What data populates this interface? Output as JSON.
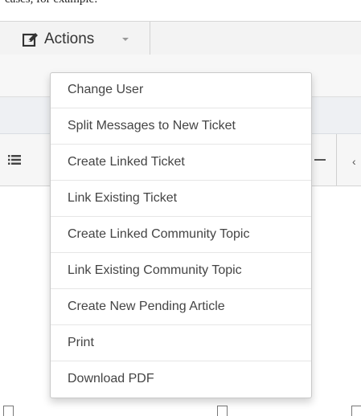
{
  "top_text": "cases, for example:",
  "toolbar": {
    "actions_label": "Actions",
    "actions_icon": "edit-icon",
    "caret_icon": "caret-down-icon"
  },
  "dropdown": {
    "items": [
      {
        "label": "Change User"
      },
      {
        "label": "Split Messages to New Ticket"
      },
      {
        "label": "Create Linked Ticket"
      },
      {
        "label": "Link Existing Ticket"
      },
      {
        "label": "Create Linked Community Topic"
      },
      {
        "label": "Link Existing Community Topic"
      },
      {
        "label": "Create New Pending Article"
      },
      {
        "label": "Print"
      },
      {
        "label": "Download PDF"
      }
    ]
  },
  "colors": {
    "toolbar_bg": "#f3f3f3",
    "menu_border": "#c9c9c9",
    "menu_text": "#444444"
  }
}
